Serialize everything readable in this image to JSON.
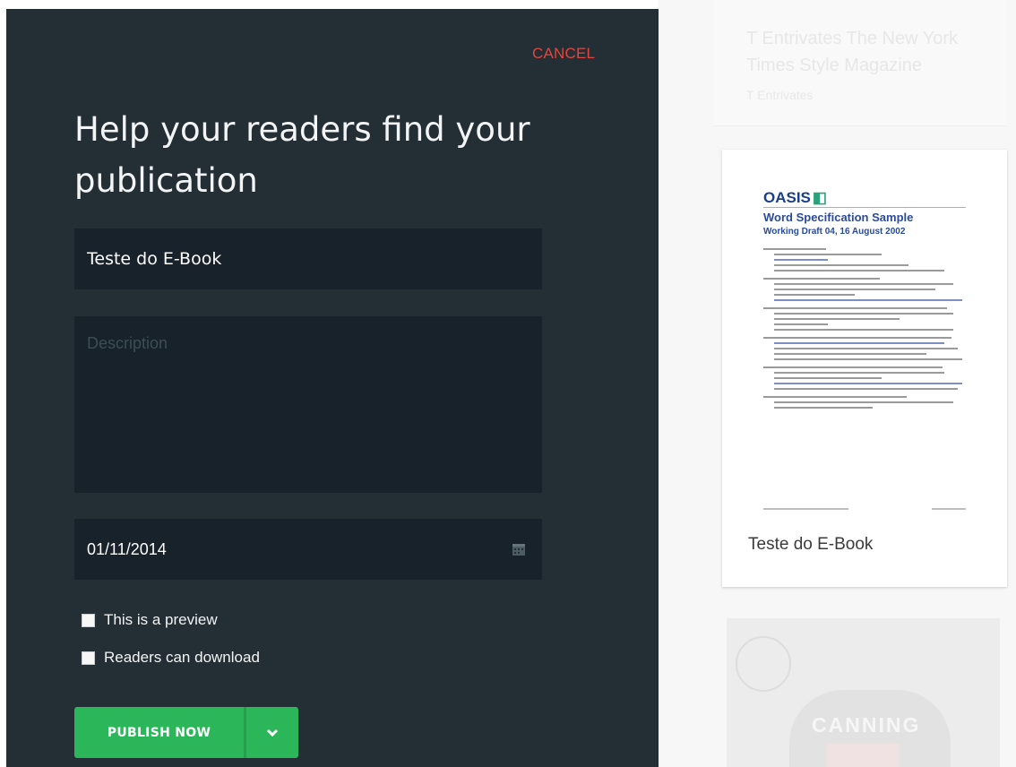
{
  "panel": {
    "cancel_label": "CANCEL",
    "heading": "Help your readers find your publication",
    "title_input": {
      "value": "Teste do E-Book"
    },
    "description_input": {
      "placeholder": "Description",
      "value": ""
    },
    "date_input": {
      "value": "01/11/2014",
      "icon": "calendar-icon"
    },
    "options": {
      "preview_label": "This is a preview",
      "preview_checked": false,
      "download_label": "Readers can download",
      "download_checked": false
    },
    "publish": {
      "label": "PUBLISH NOW",
      "dropdown_icon": "chevron-down-icon",
      "color": "#2cb65a"
    }
  },
  "previews": {
    "faded_card": {
      "title": "T Entrivates The New York Times Style Magazine",
      "subtitle": "T Entrivates"
    },
    "book_card": {
      "thumbnail": {
        "logo_text": "OASIS",
        "doc_title": "Word Specification Sample",
        "doc_subtitle": "Working Draft 04, 16 August 2002"
      },
      "title": "Teste do E-Book"
    },
    "faded_cover": {
      "text": "CANNING"
    }
  },
  "colors": {
    "panel_bg": "#232f35",
    "field_bg": "#18222a",
    "cancel": "#e0463f",
    "publish": "#2cb65a"
  }
}
